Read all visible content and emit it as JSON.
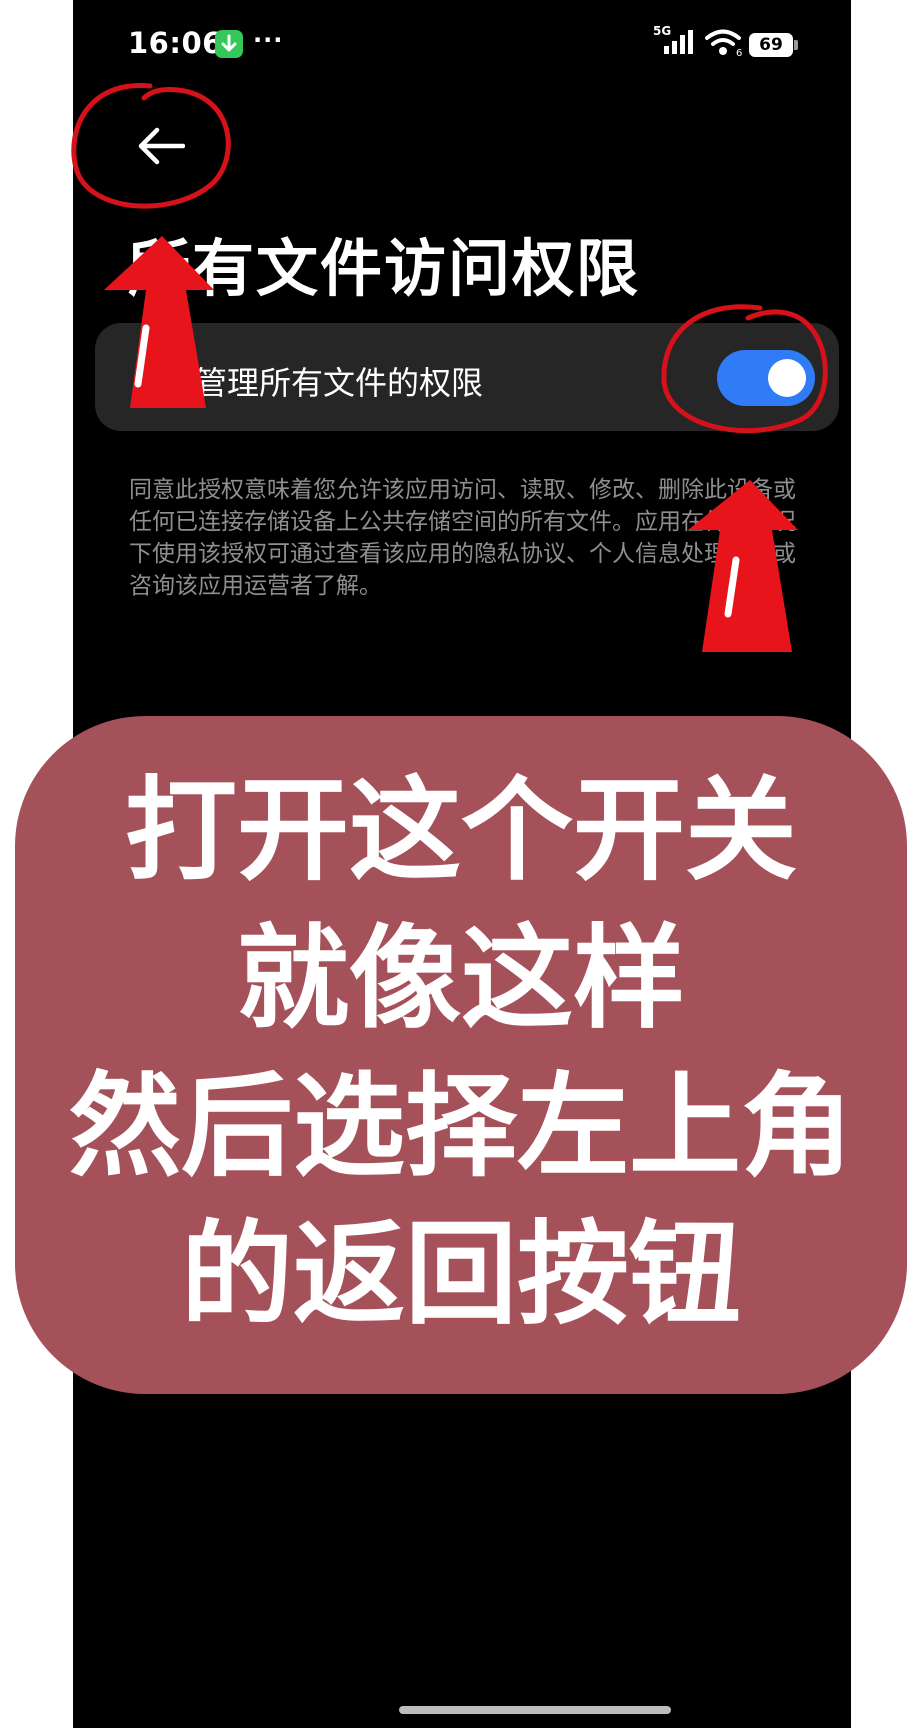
{
  "status_bar": {
    "time": "16:06",
    "dots": "···",
    "network": "5G",
    "wifi_sub": "6",
    "battery": "69"
  },
  "header": {
    "back_icon": "arrow-left-icon",
    "title": "所有文件访问权限"
  },
  "permission": {
    "label": "管理所有文件的权限",
    "enabled": true,
    "description": "同意此授权意味着您允许该应用访问、读取、修改、删除此设备或任何已连接存储设备上公共存储空间的所有文件。应用在何种情况下使用该授权可通过查看该应用的隐私协议、个人信息处理规则或咨询该应用运营者了解。"
  },
  "caption": {
    "lines": [
      "打开这个开关",
      "就像这样",
      "然后选择左上角",
      "的返回按钮"
    ]
  },
  "colors": {
    "background": "#000000",
    "card": "#262626",
    "toggle_on": "#2f7cf6",
    "annotation_red": "#e8141c",
    "caption_bg": "#a4515a"
  }
}
